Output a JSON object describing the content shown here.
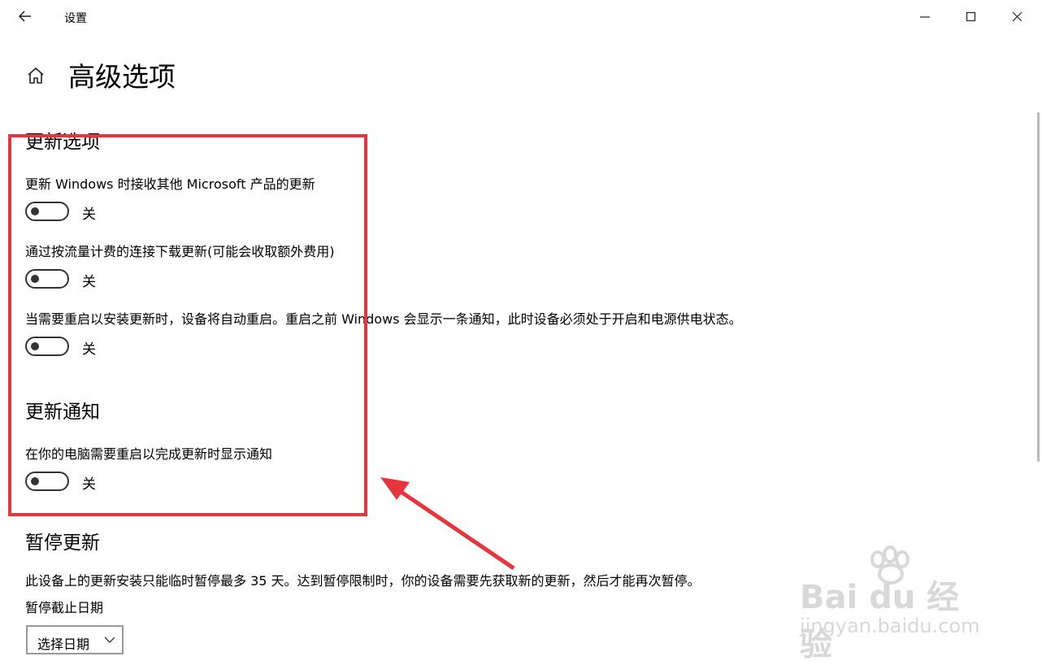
{
  "window": {
    "title": "设置",
    "controls": [
      "minimize-icon",
      "maximize-icon",
      "close-icon"
    ]
  },
  "page": {
    "title": "高级选项"
  },
  "update_options": {
    "title": "更新选项",
    "settings": [
      {
        "label": "更新 Windows 时接收其他 Microsoft 产品的更新",
        "state": "关",
        "on": false
      },
      {
        "label": "通过按流量计费的连接下载更新(可能会收取额外费用)",
        "state": "关",
        "on": false
      },
      {
        "label": "当需要重启以安装更新时，设备将自动重启。重启之前 Windows 会显示一条通知，此时设备必须处于开启和电源供电状态。",
        "state": "关",
        "on": false
      }
    ]
  },
  "update_notifications": {
    "title": "更新通知",
    "settings": [
      {
        "label": "在你的电脑需要重启以完成更新时显示通知",
        "state": "关",
        "on": false
      }
    ]
  },
  "pause_updates": {
    "title": "暂停更新",
    "description": "此设备上的更新安装只能临时暂停最多 35 天。达到暂停限制时，你的设备需要先获取新的更新，然后才能再次暂停。",
    "date_label": "暂停截止日期",
    "date_select_value": "选择日期"
  },
  "annotation": {
    "highlight_color": "#e8353d"
  },
  "watermark": {
    "brand": "Bai du 经验",
    "url": "jingyan.baidu.com"
  }
}
